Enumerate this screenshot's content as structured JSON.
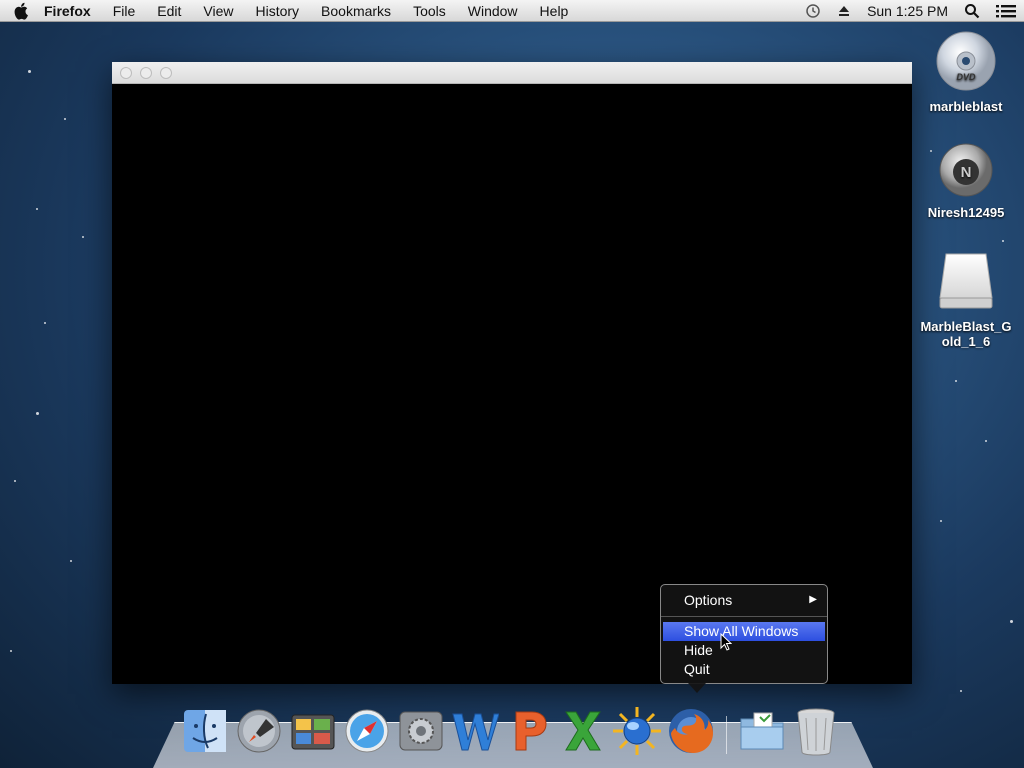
{
  "menubar": {
    "app_name": "Firefox",
    "items": [
      "File",
      "Edit",
      "View",
      "History",
      "Bookmarks",
      "Tools",
      "Window",
      "Help"
    ],
    "clock": "Sun 1:25 PM"
  },
  "desktop": {
    "icons": [
      {
        "label": "marbleblast",
        "icon": "dvd-icon"
      },
      {
        "label": "Niresh12495",
        "icon": "disk-image-icon"
      },
      {
        "label": "MarbleBlast_G\nold_1_6",
        "icon": "removable-drive-icon"
      }
    ]
  },
  "context_menu": {
    "options_label": "Options",
    "show_all_label": "Show All Windows",
    "hide_label": "Hide",
    "quit_label": "Quit"
  },
  "dock": {
    "items": [
      "finder-icon",
      "launchpad-icon",
      "image-capture-icon",
      "safari-icon",
      "system-preferences-icon",
      "word-icon",
      "powerpoint-icon",
      "excel-icon",
      "network-icon",
      "firefox-icon",
      "documents-folder-icon",
      "trash-icon"
    ]
  }
}
